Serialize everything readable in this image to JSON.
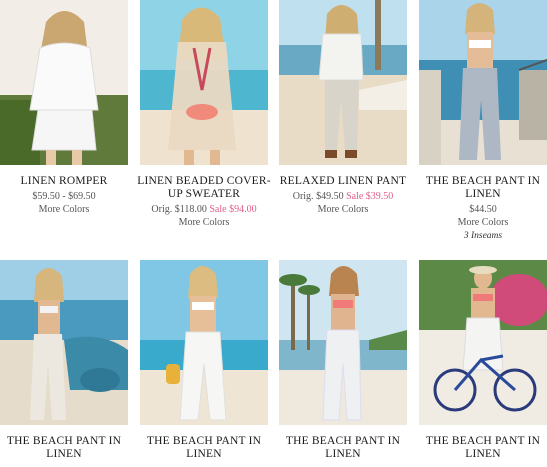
{
  "products": [
    {
      "name": "LINEN ROMPER",
      "price": "$59.50 - $69.50",
      "orig_label": "",
      "orig_price": "",
      "sale_label": "",
      "sale_price": "",
      "more": "More Colors",
      "note": ""
    },
    {
      "name": "LINEN BEADED COVER-UP SWEATER",
      "price": "",
      "orig_label": "Orig.",
      "orig_price": "$118.00",
      "sale_label": "Sale",
      "sale_price": "$94.00",
      "more": "More Colors",
      "note": ""
    },
    {
      "name": "RELAXED LINEN PANT",
      "price": "",
      "orig_label": "Orig.",
      "orig_price": "$49.50",
      "sale_label": "Sale",
      "sale_price": "$39.50",
      "more": "More Colors",
      "note": ""
    },
    {
      "name": "THE BEACH PANT IN LINEN",
      "price": "$44.50",
      "orig_label": "",
      "orig_price": "",
      "sale_label": "",
      "sale_price": "",
      "more": "More Colors",
      "note": "3 Inseams"
    },
    {
      "name": "THE BEACH PANT IN LINEN",
      "price": "",
      "orig_label": "",
      "orig_price": "",
      "sale_label": "",
      "sale_price": "",
      "more": "",
      "note": ""
    },
    {
      "name": "THE BEACH PANT IN LINEN",
      "price": "",
      "orig_label": "",
      "orig_price": "",
      "sale_label": "",
      "sale_price": "",
      "more": "",
      "note": ""
    },
    {
      "name": "THE BEACH PANT IN LINEN",
      "price": "",
      "orig_label": "",
      "orig_price": "",
      "sale_label": "",
      "sale_price": "",
      "more": "",
      "note": ""
    },
    {
      "name": "THE BEACH PANT IN LINEN",
      "price": "",
      "orig_label": "",
      "orig_price": "",
      "sale_label": "",
      "sale_price": "",
      "more": "",
      "note": ""
    }
  ],
  "colors": {
    "sale": "#e0608a",
    "text": "#1a1a1a",
    "muted": "#555555"
  }
}
